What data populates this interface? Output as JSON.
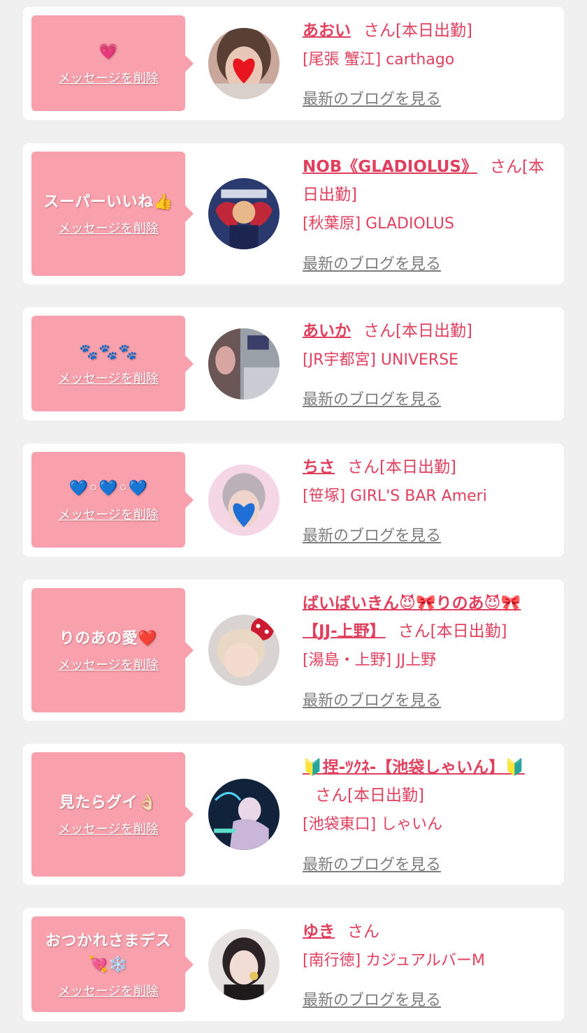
{
  "labels": {
    "delete_link": "メッセージを削除",
    "blog_link": "最新のブログを見る"
  },
  "colors": {
    "background": "#f0f0f0",
    "card": "#ffffff",
    "message_box": "#f9a0ad",
    "name_text": "#e0405e",
    "blog_link": "#7c7c7c"
  },
  "entries": [
    {
      "message": "💗",
      "name": "あおい",
      "suffix": "さん[本日出勤]",
      "shop": "[尾張 蟹江] carthago",
      "avatar_icon": "avatar-heart-sticker"
    },
    {
      "message": "スーパーいいね👍",
      "name": "NOB《GLADIOLUS》",
      "suffix": "さん[本日出勤]",
      "shop": "[秋葉原] GLADIOLUS",
      "avatar_icon": "avatar-red-wings-cartoon"
    },
    {
      "message": "🐾🐾🐾",
      "name": "あいか",
      "suffix": "さん[本日出勤]",
      "shop": "[JR宇都宮] UNIVERSE",
      "avatar_icon": "avatar-room-photo"
    },
    {
      "message": "💙◦💙◦💙",
      "name": "ちさ",
      "suffix": "さん[本日出勤]",
      "shop": "[笹塚] GIRL'S BAR Ameri",
      "avatar_icon": "avatar-blue-heart-sticker"
    },
    {
      "message": "りのあの愛❤️",
      "name": "ばいばいきん😈🎀りのあ😈🎀【JJ-上野】",
      "suffix": "さん[本日出勤]",
      "shop": "[湯島・上野] JJ上野",
      "avatar_icon": "avatar-minnie-ears-photo"
    },
    {
      "message": "見たらグイ👌🏻",
      "name": "🔰捏-ﾂｸﾈ-【池袋しゃいん】🔰",
      "suffix": "さん[本日出勤]",
      "shop": "[池袋東口] しゃいん",
      "avatar_icon": "avatar-neon-photo"
    },
    {
      "message": "おつかれさまデス💘❄️",
      "name": "ゆき",
      "suffix": "さん",
      "shop": "[南行徳] カジュアルバーM",
      "avatar_icon": "avatar-selfie-photo"
    }
  ]
}
